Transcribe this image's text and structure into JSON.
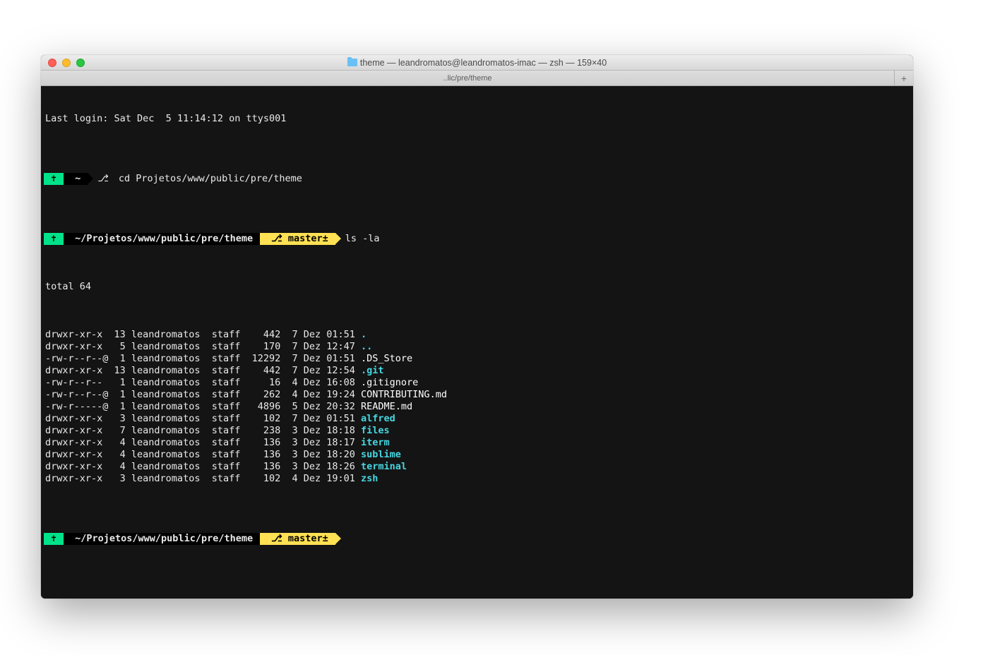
{
  "window": {
    "title": "theme — leandromatos@leandromatos-imac — zsh — 159×40",
    "tab_label": "..lic/pre/theme",
    "tab_add": "+"
  },
  "login_line": "Last login: Sat Dec  5 11:14:12 on ttys001",
  "p1": {
    "icon": "✝",
    "path": "~",
    "cmd": "cd Projetos/www/public/pre/theme"
  },
  "p2": {
    "icon": "✝",
    "path": "~/Projetos/www/public/pre/theme",
    "branch_icon": "⎇",
    "branch": "master±",
    "cmd": "ls -la"
  },
  "total": "total 64",
  "rows": [
    {
      "perm": "drwxr-xr-x ",
      "links": "13",
      "owner": "leandromatos",
      "group": "staff",
      "size": "   442",
      "date": " 7 Dez 01:51",
      "name": ".",
      "cls": "cyan"
    },
    {
      "perm": "drwxr-xr-x ",
      "links": " 5",
      "owner": "leandromatos",
      "group": "staff",
      "size": "   170",
      "date": " 7 Dez 12:47",
      "name": "..",
      "cls": "cyan"
    },
    {
      "perm": "-rw-r--r--@",
      "links": " 1",
      "owner": "leandromatos",
      "group": "staff",
      "size": " 12292",
      "date": " 7 Dez 01:51",
      "name": ".DS_Store",
      "cls": "white"
    },
    {
      "perm": "drwxr-xr-x ",
      "links": "13",
      "owner": "leandromatos",
      "group": "staff",
      "size": "   442",
      "date": " 7 Dez 12:54",
      "name": ".git",
      "cls": "cyan"
    },
    {
      "perm": "-rw-r--r-- ",
      "links": " 1",
      "owner": "leandromatos",
      "group": "staff",
      "size": "    16",
      "date": " 4 Dez 16:08",
      "name": ".gitignore",
      "cls": "white"
    },
    {
      "perm": "-rw-r--r--@",
      "links": " 1",
      "owner": "leandromatos",
      "group": "staff",
      "size": "   262",
      "date": " 4 Dez 19:24",
      "name": "CONTRIBUTING.md",
      "cls": "white"
    },
    {
      "perm": "-rw-r-----@",
      "links": " 1",
      "owner": "leandromatos",
      "group": "staff",
      "size": "  4896",
      "date": " 5 Dez 20:32",
      "name": "README.md",
      "cls": "white"
    },
    {
      "perm": "drwxr-xr-x ",
      "links": " 3",
      "owner": "leandromatos",
      "group": "staff",
      "size": "   102",
      "date": " 7 Dez 01:51",
      "name": "alfred",
      "cls": "cyan"
    },
    {
      "perm": "drwxr-xr-x ",
      "links": " 7",
      "owner": "leandromatos",
      "group": "staff",
      "size": "   238",
      "date": " 3 Dez 18:18",
      "name": "files",
      "cls": "cyan"
    },
    {
      "perm": "drwxr-xr-x ",
      "links": " 4",
      "owner": "leandromatos",
      "group": "staff",
      "size": "   136",
      "date": " 3 Dez 18:17",
      "name": "iterm",
      "cls": "cyan"
    },
    {
      "perm": "drwxr-xr-x ",
      "links": " 4",
      "owner": "leandromatos",
      "group": "staff",
      "size": "   136",
      "date": " 3 Dez 18:20",
      "name": "sublime",
      "cls": "cyan"
    },
    {
      "perm": "drwxr-xr-x ",
      "links": " 4",
      "owner": "leandromatos",
      "group": "staff",
      "size": "   136",
      "date": " 3 Dez 18:26",
      "name": "terminal",
      "cls": "cyan"
    },
    {
      "perm": "drwxr-xr-x ",
      "links": " 3",
      "owner": "leandromatos",
      "group": "staff",
      "size": "   102",
      "date": " 4 Dez 19:01",
      "name": "zsh",
      "cls": "cyan"
    }
  ],
  "p3": {
    "icon": "✝",
    "path": "~/Projetos/www/public/pre/theme",
    "branch_icon": "⎇",
    "branch": "master±"
  }
}
